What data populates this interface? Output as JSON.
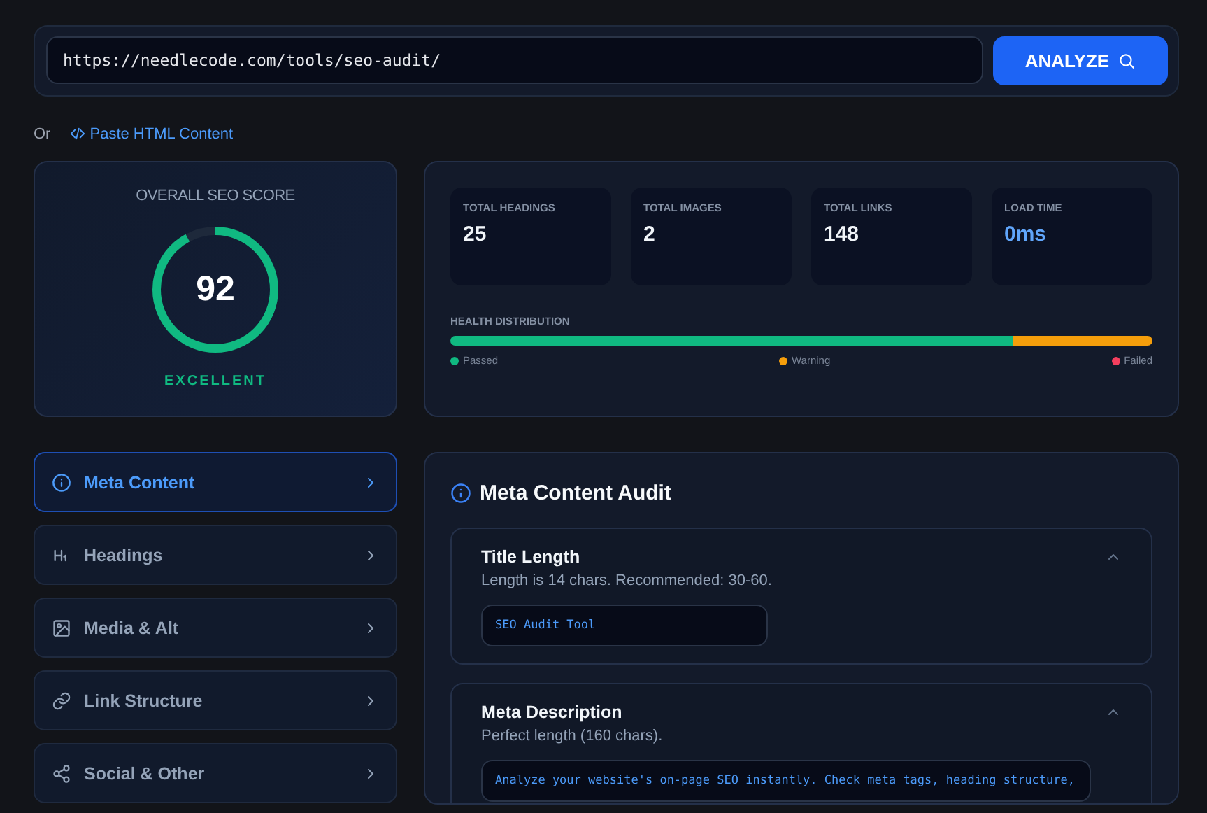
{
  "url_bar": {
    "value": "https://needlecode.com/tools/seo-audit/",
    "button": "ANALYZE"
  },
  "alt_input": {
    "prefix": "Or",
    "link": "Paste HTML Content"
  },
  "score": {
    "title": "OVERALL SEO SCORE",
    "value": "92",
    "level": 0.92,
    "rating": "EXCELLENT"
  },
  "stats": [
    {
      "label": "TOTAL HEADINGS",
      "value": "25",
      "kind": "count"
    },
    {
      "label": "TOTAL IMAGES",
      "value": "2",
      "kind": "count"
    },
    {
      "label": "TOTAL LINKS",
      "value": "148",
      "kind": "count"
    },
    {
      "label": "LOAD TIME",
      "value": "0ms",
      "kind": "time"
    }
  ],
  "health": {
    "title": "HEALTH DISTRIBUTION",
    "segments": [
      {
        "level": 0.8,
        "color": "#10b981"
      },
      {
        "level": 0.2,
        "color": "#f59e0b"
      }
    ],
    "legend": [
      {
        "name": "Passed",
        "color": "#10b981"
      },
      {
        "name": "Warning",
        "color": "#f59e0b"
      },
      {
        "name": "Failed",
        "color": "#f43f5e"
      }
    ]
  },
  "sidebar": {
    "items": [
      {
        "label": "Meta Content",
        "kind": "info",
        "selected": true
      },
      {
        "label": "Headings",
        "kind": "heading",
        "selected": false
      },
      {
        "label": "Media & Alt",
        "kind": "image",
        "selected": false
      },
      {
        "label": "Link Structure",
        "kind": "link",
        "selected": false
      },
      {
        "label": "Social & Other",
        "kind": "share",
        "selected": false
      }
    ]
  },
  "audit": {
    "title": "Meta Content Audit",
    "checks": [
      {
        "title": "Title Length",
        "message": "Length is 14 chars. Recommended: 30-60.",
        "value": "SEO Audit Tool",
        "expanded": true
      },
      {
        "title": "Meta Description",
        "message": "Perfect length (160 chars).",
        "value": "Analyze your website's on-page SEO instantly. Check meta tags, heading structure,",
        "expanded": true
      }
    ]
  }
}
